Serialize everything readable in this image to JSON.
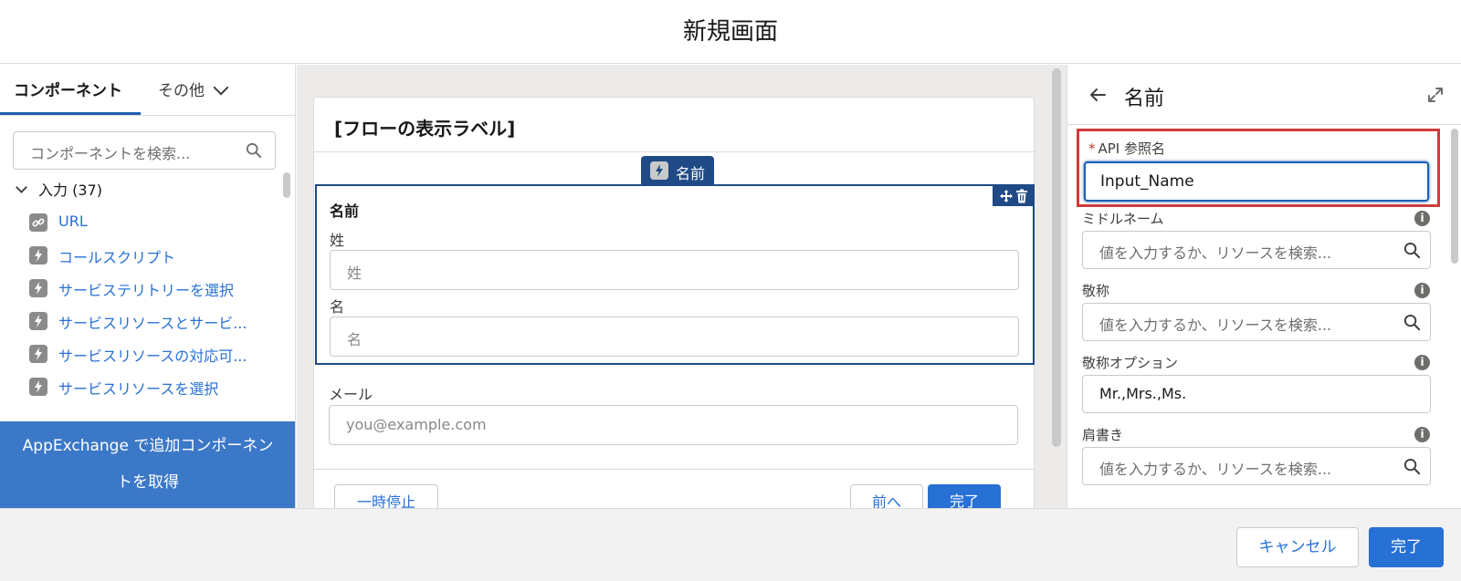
{
  "header": {
    "title": "新規画面"
  },
  "left_panel": {
    "tabs": [
      {
        "label": "コンポーネント",
        "active": true
      },
      {
        "label": "その他",
        "active": false
      }
    ],
    "search": {
      "placeholder": "コンポーネントを検索..."
    },
    "section": {
      "label": "入力 (37)"
    },
    "components": [
      {
        "label": "URL",
        "icon": "link-icon"
      },
      {
        "label": "コールスクリプト",
        "icon": "lightning-icon"
      },
      {
        "label": "サービステリトリーを選択",
        "icon": "lightning-icon"
      },
      {
        "label": "サービスリソースとサービ...",
        "icon": "lightning-icon"
      },
      {
        "label": "サービスリソースの対応可...",
        "icon": "lightning-icon"
      },
      {
        "label": "サービスリソースを選択",
        "icon": "lightning-icon"
      }
    ],
    "appexchange": {
      "line1": "AppExchange で追加コンポーネン",
      "line2": "トを取得"
    }
  },
  "canvas": {
    "flow_label": "[フローの表示ラベル]",
    "component_tag": "名前",
    "name_field": {
      "heading": "名前",
      "last_label": "姓",
      "last_placeholder": "姓",
      "first_label": "名",
      "first_placeholder": "名"
    },
    "email_field": {
      "label": "メール",
      "placeholder": "you@example.com"
    },
    "footer": {
      "pause": "一時停止",
      "previous": "前へ",
      "next": "完了"
    }
  },
  "right_panel": {
    "title": "名前",
    "api_name": {
      "label": "API 参照名",
      "required_marker": "*",
      "value": "Input_Name"
    },
    "fields": [
      {
        "label": "ミドルネーム",
        "placeholder": "値を入力するか、リソースを検索...",
        "value": ""
      },
      {
        "label": "敬称",
        "placeholder": "値を入力するか、リソースを検索...",
        "value": ""
      },
      {
        "label": "敬称オプション",
        "placeholder": "",
        "value": "Mr.,Mrs.,Ms."
      },
      {
        "label": "肩書き",
        "placeholder": "値を入力するか、リソースを検索...",
        "value": ""
      }
    ],
    "info_glyph": "i"
  },
  "bottom_bar": {
    "cancel": "キャンセル",
    "done": "完了"
  },
  "colors": {
    "brand": "#2770d4",
    "selected_border": "#1f4a85",
    "highlight": "#d33b3b"
  }
}
